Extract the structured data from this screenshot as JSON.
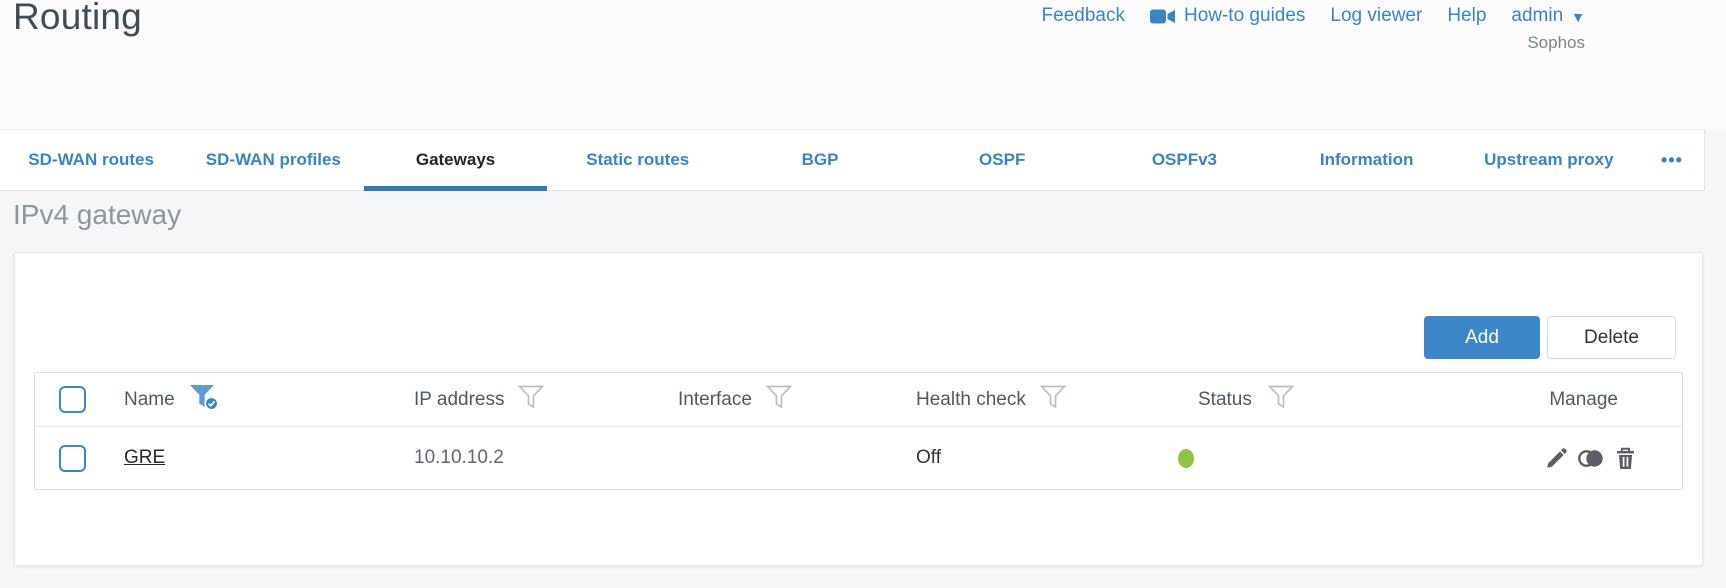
{
  "page": {
    "title": "Routing"
  },
  "header": {
    "links": [
      "Feedback",
      "How-to guides",
      "Log viewer",
      "Help"
    ],
    "user": "admin",
    "brand": "Sophos"
  },
  "tabs": [
    {
      "label": "SD-WAN routes",
      "active": false
    },
    {
      "label": "SD-WAN profiles",
      "active": false
    },
    {
      "label": "Gateways",
      "active": true
    },
    {
      "label": "Static routes",
      "active": false
    },
    {
      "label": "BGP",
      "active": false
    },
    {
      "label": "OSPF",
      "active": false
    },
    {
      "label": "OSPFv3",
      "active": false
    },
    {
      "label": "Information",
      "active": false
    },
    {
      "label": "Upstream proxy",
      "active": false
    },
    {
      "label": "•••",
      "active": false
    }
  ],
  "section": {
    "heading": "IPv4 gateway"
  },
  "toolbar": {
    "add_label": "Add",
    "delete_label": "Delete"
  },
  "table": {
    "columns": [
      {
        "label": "Name",
        "filter": "applied"
      },
      {
        "label": "IP address",
        "filter": "available"
      },
      {
        "label": "Interface",
        "filter": "available"
      },
      {
        "label": "Health check",
        "filter": "available"
      },
      {
        "label": "Status",
        "filter": "available"
      },
      {
        "label": "Manage",
        "filter": "none"
      }
    ],
    "rows": [
      {
        "name": "GRE",
        "ip": "10.10.10.2",
        "interface": "",
        "health_check": "Off",
        "status": "green"
      }
    ]
  },
  "colors": {
    "accent_blue": "#3a84c5",
    "active_tab_underline": "#3279be",
    "add_button": "#3c87c9",
    "status_green": "#8dc63f"
  }
}
